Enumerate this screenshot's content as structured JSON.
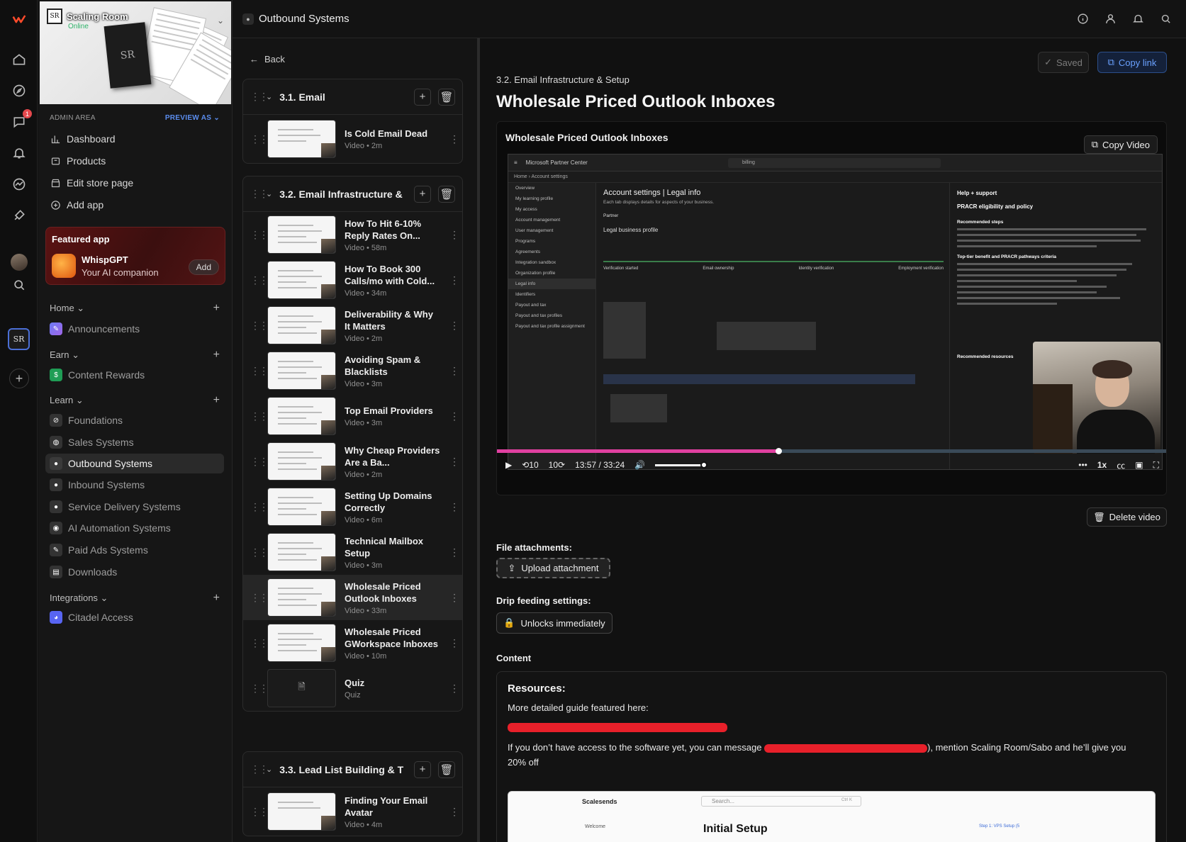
{
  "topbar": {
    "title": "Outbound Systems"
  },
  "store": {
    "name": "Scaling Room",
    "status": "Online",
    "logo_text": "SR"
  },
  "nav": {
    "admin_label": "ADMIN AREA",
    "preview_as": "PREVIEW AS",
    "admin_items": [
      {
        "label": "Dashboard"
      },
      {
        "label": "Products"
      },
      {
        "label": "Edit store page"
      },
      {
        "label": "Add app"
      }
    ],
    "featured": {
      "title": "Featured app",
      "app_name": "WhispGPT",
      "app_desc": "Your AI companion",
      "add_label": "Add"
    },
    "sections": [
      {
        "label": "Home"
      },
      {
        "label": "Earn"
      },
      {
        "label": "Learn"
      },
      {
        "label": "Integrations"
      }
    ],
    "home_items": [
      {
        "label": "Announcements"
      }
    ],
    "earn_items": [
      {
        "label": "Content Rewards"
      }
    ],
    "learn_items": [
      {
        "label": "Foundations"
      },
      {
        "label": "Sales Systems"
      },
      {
        "label": "Outbound Systems"
      },
      {
        "label": "Inbound Systems"
      },
      {
        "label": "Service Delivery Systems"
      },
      {
        "label": "AI Automation Systems"
      },
      {
        "label": "Paid Ads Systems"
      },
      {
        "label": "Downloads"
      }
    ],
    "integration_items": [
      {
        "label": "Citadel Access"
      }
    ],
    "notification_count": "1"
  },
  "lessons_panel": {
    "back_label": "Back",
    "modules": [
      {
        "title": "3.1. Email",
        "lessons": [
          {
            "title": "Is Cold Email Dead",
            "meta": "Video • 2m"
          }
        ]
      },
      {
        "title": "3.2. Email Infrastructure &",
        "lessons": [
          {
            "title": "How To Hit 6-10% Reply Rates On...",
            "meta": "Video • 58m"
          },
          {
            "title": "How To Book 300 Calls/mo with Cold...",
            "meta": "Video • 34m"
          },
          {
            "title": "Deliverability & Why It Matters",
            "meta": "Video • 2m"
          },
          {
            "title": "Avoiding Spam & Blacklists",
            "meta": "Video • 3m"
          },
          {
            "title": "Top Email Providers",
            "meta": "Video • 3m"
          },
          {
            "title": "Why Cheap Providers Are a Ba...",
            "meta": "Video • 2m"
          },
          {
            "title": "Setting Up Domains Correctly",
            "meta": "Video • 6m"
          },
          {
            "title": "Technical Mailbox Setup",
            "meta": "Video • 3m"
          },
          {
            "title": "Wholesale Priced Outlook Inboxes",
            "meta": "Video • 33m"
          },
          {
            "title": "Wholesale Priced GWorkspace Inboxes",
            "meta": "Video • 10m"
          },
          {
            "title": "Quiz",
            "meta": "Quiz"
          }
        ]
      },
      {
        "title": "3.3. Lead List Building & T",
        "lessons": [
          {
            "title": "Finding Your Email Avatar",
            "meta": "Video • 4m"
          }
        ]
      }
    ]
  },
  "main": {
    "saved_label": "Saved",
    "copy_link_label": "Copy link",
    "breadcrumb": "3.2. Email Infrastructure & Setup",
    "title": "Wholesale Priced Outlook Inboxes",
    "player": {
      "title": "Wholesale Priced Outlook Inboxes",
      "copy_video_label": "Copy Video",
      "time": "13:57 / 33:24",
      "progress": 0.42,
      "volume": 1.0,
      "speed": "1x",
      "skip_back": "10",
      "skip_fwd": "10"
    },
    "screen": {
      "app": "Microsoft Partner Center",
      "search": "billing",
      "crumb_home": "Home",
      "crumb_page": "Account settings",
      "heading": "Account settings | Legal info",
      "sub": "Each tab displays details for aspects of your business.",
      "tab": "Partner",
      "section": "Legal business profile",
      "steps": [
        "Verification started",
        "Email ownership",
        "Identity verification",
        "Employment verification"
      ],
      "menu": [
        "Overview",
        "My learning profile",
        "My access",
        "Account management",
        "User management",
        "Programs",
        "Agreements",
        "Integration sandbox",
        "Organization profile",
        "Legal info",
        "Identifiers",
        "Payout and tax",
        "Payout and tax profiles",
        "Payout and tax profile assignment"
      ],
      "help_title": "Help + support",
      "help_heading": "PRACR eligibility and policy",
      "help_sub": "Recommended steps",
      "help_benefits": "Top-tier benefit and PRACR pathways criteria",
      "help_resources": "Recommended resources"
    },
    "delete_video_label": "Delete video",
    "file_attachments_label": "File attachments:",
    "upload_label": "Upload attachment",
    "drip_label": "Drip feeding settings:",
    "unlocks_label": "Unlocks immediately",
    "content_label": "Content",
    "resources": {
      "heading": "Resources:",
      "line1": "More detailed guide featured here:",
      "line2_a": "If you don’t have access to the software yet, you can message",
      "line2_b": "), mention Scaling Room/Sabo and he’ll give you 20% off",
      "embed_brand": "Scalesends",
      "embed_search": "Search...",
      "embed_kbd": "Ctrl K",
      "embed_welcome": "Welcome",
      "embed_heading": "Initial Setup",
      "embed_step": "Step 1: VPS Setup (5"
    }
  },
  "colors": {
    "accent": "#5b8def",
    "progress": "#e040a0",
    "redaction": "#e8202a",
    "featured_bg": "#4a1010"
  }
}
